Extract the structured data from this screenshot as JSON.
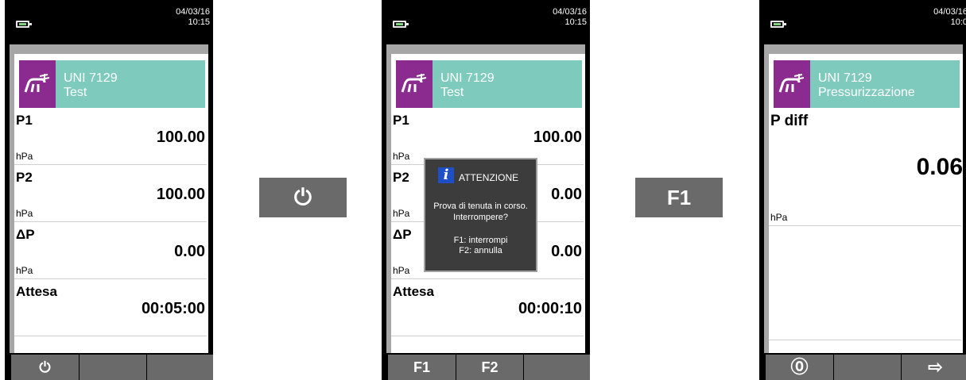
{
  "screen1": {
    "status": {
      "date": "04/03/16",
      "time": "10:15"
    },
    "header": {
      "line1": "UNI 7129",
      "line2": "Test"
    },
    "measurements": [
      {
        "name": "P1",
        "value": "100.00",
        "unit": "hPa"
      },
      {
        "name": "P2",
        "value": "100.00",
        "unit": "hPa"
      },
      {
        "name": "ΔP",
        "value": "0.00",
        "unit": "hPa"
      },
      {
        "name": "Attesa",
        "value": "00:05:00",
        "unit": ""
      }
    ],
    "softkeys": [
      "⏻",
      "",
      ""
    ]
  },
  "arrow1": {
    "label": "⏻"
  },
  "screen2": {
    "status": {
      "date": "04/03/16",
      "time": "10:15"
    },
    "header": {
      "line1": "UNI 7129",
      "line2": "Test"
    },
    "measurements": [
      {
        "name": "P1",
        "value": "100.00",
        "unit": "hPa"
      },
      {
        "name": "P2",
        "value": "0.00",
        "unit": "hPa"
      },
      {
        "name": "ΔP",
        "value": "0.00",
        "unit": "hPa"
      },
      {
        "name": "Attesa",
        "value": "00:00:10",
        "unit": ""
      }
    ],
    "dialog": {
      "title": "ATTENZIONE",
      "message_line1": "Prova di tenuta in corso.",
      "message_line2": "Interrompere?",
      "option1": "F1: interrompi",
      "option2": "F2: annulla"
    },
    "softkeys": [
      "F1",
      "F2",
      ""
    ]
  },
  "arrow2": {
    "label": "F1"
  },
  "screen3": {
    "status": {
      "date": "04/03/16",
      "time": "10:0"
    },
    "header": {
      "line1": "UNI 7129",
      "line2": "Pressurizzazione"
    },
    "measurement": {
      "name": "P diff",
      "value": "0.06",
      "unit": "hPa"
    },
    "softkeys": [
      "⓪",
      "",
      "⇨"
    ]
  },
  "colors": {
    "header_teal": "#7ecbbd",
    "icon_purple": "#8b2a8f",
    "softkey_gray": "#6a6a6a",
    "info_blue": "#1e4fc7"
  }
}
